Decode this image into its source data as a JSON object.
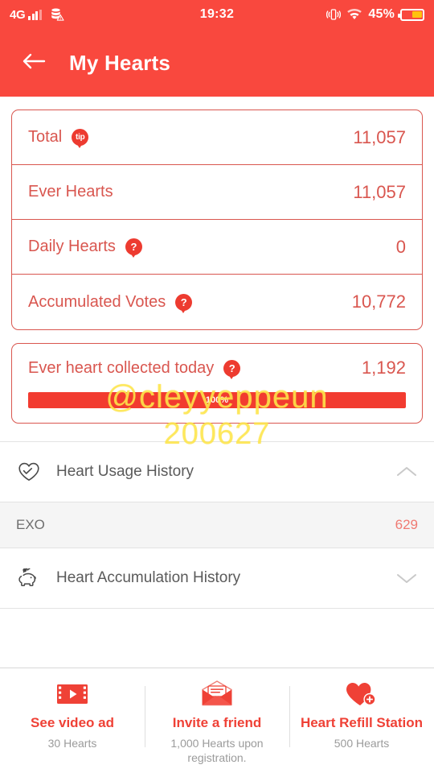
{
  "statusbar": {
    "network_label": "4G",
    "signal_icon": "signal-bars-icon",
    "data_icon": "mobile-data-off-icon",
    "time": "19:32",
    "vibrate_icon": "vibrate-icon",
    "wifi_icon": "wifi-icon",
    "battery_percent": "45%",
    "battery_icon": "battery-icon"
  },
  "header": {
    "back_icon": "back-arrow-icon",
    "title": "My Hearts",
    "background_color": "#F9483E"
  },
  "summary_card": {
    "rows": [
      {
        "label": "Total",
        "badge": "tip",
        "badge_icon": "tip-badge-icon",
        "value": "11,057"
      },
      {
        "label": "Ever Hearts",
        "badge": "",
        "badge_icon": "",
        "value": "11,057"
      },
      {
        "label": "Daily Hearts",
        "badge": "?",
        "badge_icon": "help-badge-icon",
        "value": "0"
      },
      {
        "label": "Accumulated Votes",
        "badge": "?",
        "badge_icon": "help-badge-icon",
        "value": "10,772"
      }
    ]
  },
  "collected_card": {
    "label": "Ever heart collected today",
    "badge": "?",
    "badge_icon": "help-badge-icon",
    "value": "1,192",
    "progress_percent": "100%",
    "progress_fill_width": "100%",
    "progress_color": "#F23B30",
    "progress_track_color": "#F4A9A3"
  },
  "usage_history": {
    "icon": "heart-check-icon",
    "title": "Heart Usage History",
    "chevron": "chevron-up-icon",
    "expanded": true,
    "items": [
      {
        "name": "EXO",
        "value": "629"
      }
    ]
  },
  "accumulation_history": {
    "icon": "piggy-bank-heart-icon",
    "title": "Heart Accumulation History",
    "chevron": "chevron-down-icon",
    "expanded": false
  },
  "bottom_actions": [
    {
      "icon": "video-ad-icon",
      "label": "See video ad",
      "sub": "30 Hearts"
    },
    {
      "icon": "envelope-invite-icon",
      "label": "Invite a friend",
      "sub": "1,000 Hearts upon registration."
    },
    {
      "icon": "heart-plus-icon",
      "label": "Heart Refill Station",
      "sub": "500 Hearts"
    }
  ],
  "watermark": {
    "line1": "@cleyyeppeun",
    "line2": "200627",
    "color": "#FFE950"
  },
  "colors": {
    "brand_red": "#F9483E",
    "card_red": "#D9564F",
    "badge_red": "#ED3B30",
    "action_red": "#EF4136",
    "sub_value_red": "#F07A72",
    "battery_yellow": "#FFC20E"
  }
}
